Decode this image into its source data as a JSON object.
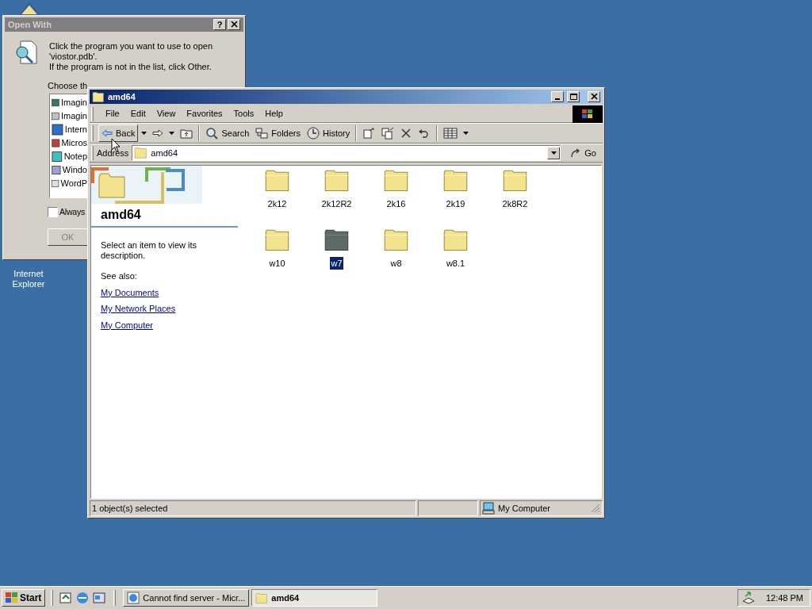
{
  "desktop": {
    "icons": [
      {
        "label": "Internet Explorer"
      }
    ]
  },
  "open_with": {
    "title": "Open With",
    "help": "?",
    "message_lines": [
      "Click the program you want to use to open",
      "'viostor.pdb'.",
      "If the program is not in the list, click Other."
    ],
    "list_label": "Choose th",
    "programs": [
      "Imagin",
      "Imagin",
      "Intern",
      "Micros",
      "Notep",
      "Windo",
      "WordP"
    ],
    "always": {
      "label": "Always",
      "checked": false
    },
    "ok": "OK"
  },
  "explorer": {
    "title": "amd64",
    "menu": [
      "File",
      "Edit",
      "View",
      "Favorites",
      "Tools",
      "Help"
    ],
    "toolbar": [
      {
        "kind": "back",
        "label": "Back"
      },
      {
        "kind": "forward"
      },
      {
        "kind": "up"
      },
      {
        "kind": "search",
        "label": "Search"
      },
      {
        "kind": "folders",
        "label": "Folders"
      },
      {
        "kind": "history",
        "label": "History"
      },
      {
        "kind": "move"
      },
      {
        "kind": "copy"
      },
      {
        "kind": "delete"
      },
      {
        "kind": "undo"
      },
      {
        "kind": "views"
      }
    ],
    "address": {
      "label": "Address",
      "value": "amd64",
      "go": "Go"
    },
    "info": {
      "title": "amd64",
      "description": "Select an item to view its description.",
      "see_also": "See also:",
      "links": [
        "My Documents",
        "My Network Places",
        "My Computer"
      ]
    },
    "folders": [
      {
        "name": "2k12",
        "selected": false
      },
      {
        "name": "2k12R2",
        "selected": false
      },
      {
        "name": "2k16",
        "selected": false
      },
      {
        "name": "2k19",
        "selected": false
      },
      {
        "name": "2k8R2",
        "selected": false
      },
      {
        "name": "w10",
        "selected": false
      },
      {
        "name": "w7",
        "selected": true
      },
      {
        "name": "w8",
        "selected": false
      },
      {
        "name": "w8.1",
        "selected": false
      }
    ],
    "status": {
      "text": "1 object(s) selected",
      "zone": "My Computer"
    }
  },
  "taskbar": {
    "start": "Start",
    "tasks": [
      {
        "label": "Cannot find server - Micr...",
        "kind": "browser",
        "selected": false
      },
      {
        "label": "amd64",
        "kind": "folder",
        "selected": true
      }
    ],
    "clock": "12:48 PM"
  }
}
